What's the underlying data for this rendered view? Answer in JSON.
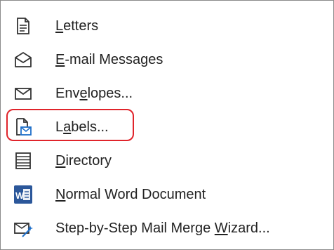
{
  "menu": {
    "items": [
      {
        "key": "letters",
        "pre": "",
        "acc": "L",
        "post": "etters",
        "icon": "letters-doc-icon"
      },
      {
        "key": "email",
        "pre": "",
        "acc": "E",
        "post": "-mail Messages",
        "icon": "email-envelope-open-icon"
      },
      {
        "key": "envelopes",
        "pre": "Env",
        "acc": "e",
        "post": "lopes...",
        "icon": "envelope-icon"
      },
      {
        "key": "labels",
        "pre": "L",
        "acc": "a",
        "post": "bels...",
        "icon": "labels-icon"
      },
      {
        "key": "directory",
        "pre": "",
        "acc": "D",
        "post": "irectory",
        "icon": "directory-list-icon"
      },
      {
        "key": "normal",
        "pre": "",
        "acc": "N",
        "post": "ormal Word Document",
        "icon": "word-document-icon"
      },
      {
        "key": "wizard",
        "pre": "Step-by-Step Mail Merge ",
        "acc": "W",
        "post": "izard...",
        "icon": "mail-merge-wizard-icon"
      }
    ],
    "highlighted_item": "labels",
    "highlight_color": "#e0242b",
    "word_icon_text": "W",
    "word_icon_color": "#2b579a"
  }
}
